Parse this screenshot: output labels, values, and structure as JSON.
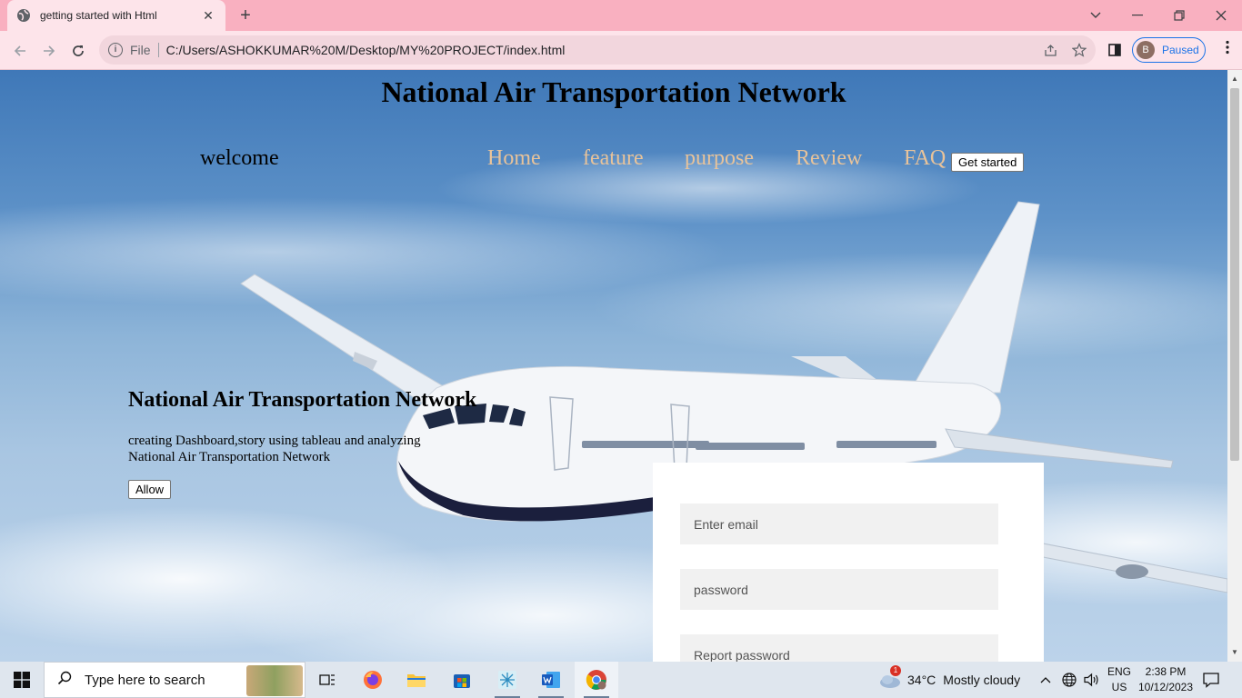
{
  "browser": {
    "tab_title": "getting started with Html",
    "url_scheme_label": "File",
    "url": "C:/Users/ASHOKKUMAR%20M/Desktop/MY%20PROJECT/index.html",
    "profile_initial": "B",
    "profile_status": "Paused"
  },
  "page": {
    "heading": "National Air Transportation Network",
    "welcome": "welcome",
    "nav": [
      "Home",
      "feature",
      "purpose",
      "Review",
      "FAQ"
    ],
    "get_started": "Get started",
    "hero_title": "National Air Transportation Network",
    "hero_text": "creating Dashboard,story using tableau and analyzing National Air Transportation Network",
    "allow_button": "Allow",
    "form": {
      "email_placeholder": "Enter email",
      "password_placeholder": "password",
      "repeat_placeholder": "Report password"
    }
  },
  "taskbar": {
    "search_placeholder": "Type here to search",
    "weather_badge": "1",
    "temperature": "34°C",
    "weather": "Mostly cloudy",
    "lang_top": "ENG",
    "lang_bottom": "US",
    "time": "2:38 PM",
    "date": "10/12/2023"
  },
  "colors": {
    "tabstrip": "#f9b0c0",
    "toolbar": "#fde4ea",
    "nav_link": "#e8c39a",
    "profile_accent": "#1a73e8"
  }
}
